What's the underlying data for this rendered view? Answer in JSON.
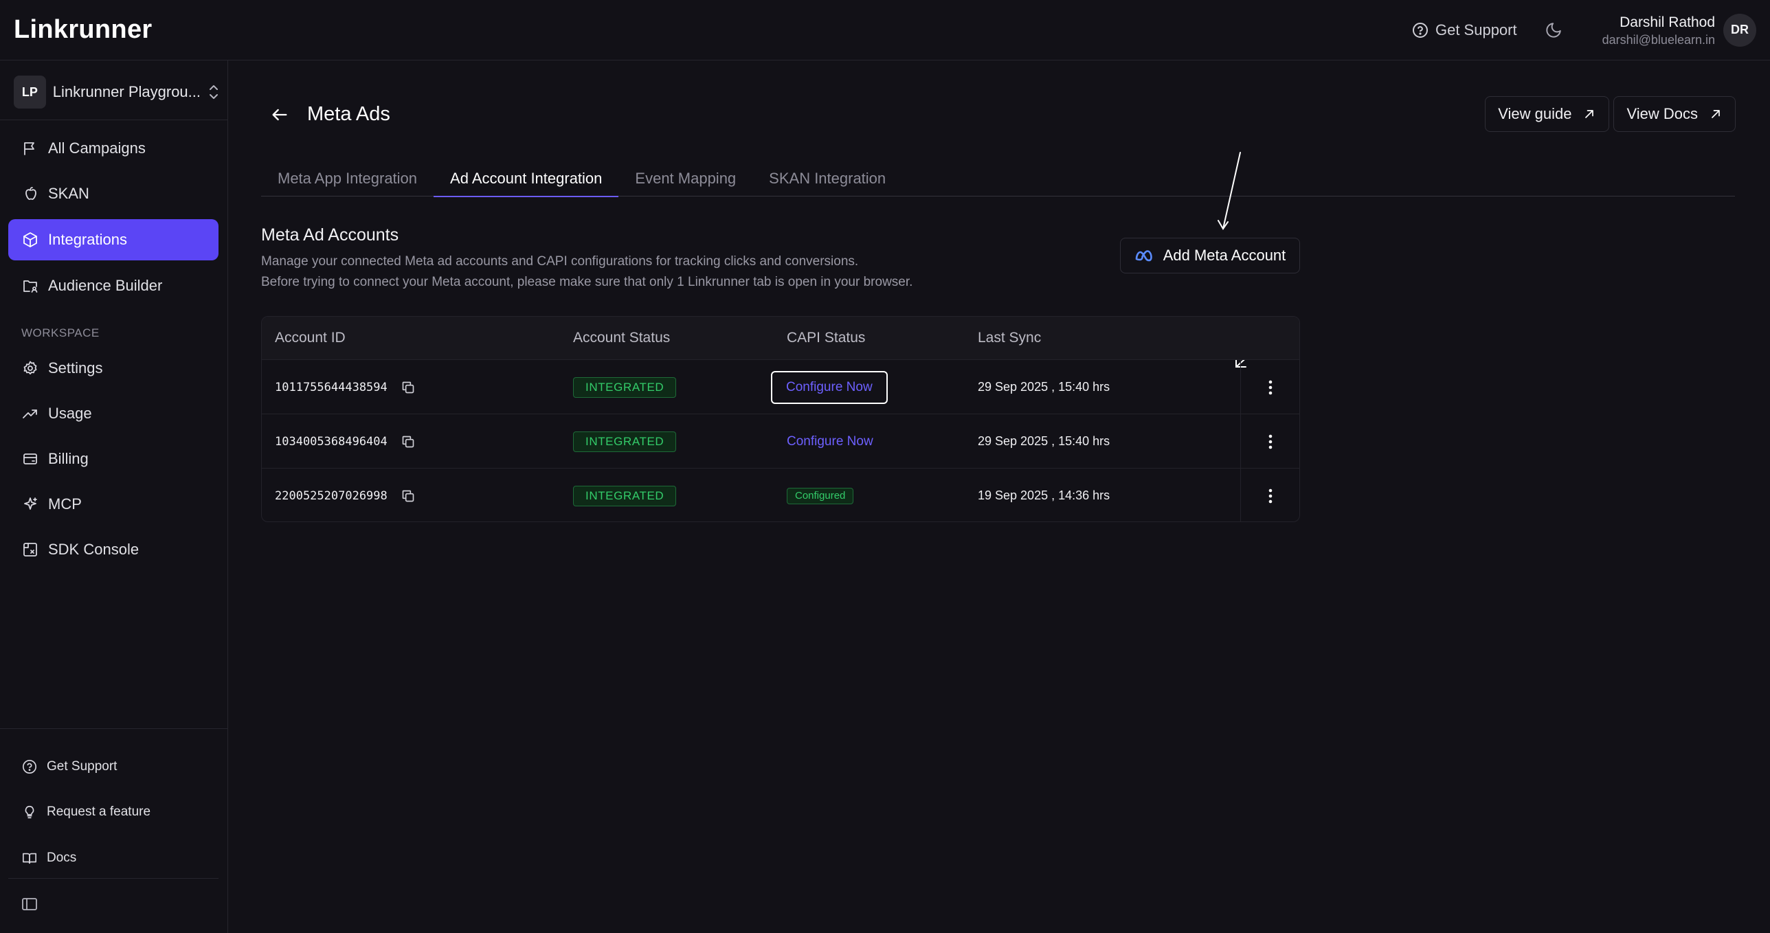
{
  "app": {
    "logo": "Linkrunner"
  },
  "topbar": {
    "support_label": "Get Support",
    "user_name": "Darshil Rathod",
    "user_email": "darshil@bluelearn.in",
    "user_initials": "DR"
  },
  "sidebar": {
    "workspace_initials": "LP",
    "workspace_name": "Linkrunner Playgrou...",
    "main_items": [
      {
        "label": "All Campaigns",
        "icon": "campaign-flag-icon"
      },
      {
        "label": "SKAN",
        "icon": "apple-icon"
      },
      {
        "label": "Integrations",
        "icon": "cube-icon",
        "active": true
      },
      {
        "label": "Audience Builder",
        "icon": "folder-user-icon"
      }
    ],
    "workspace_label": "WORKSPACE",
    "workspace_items": [
      {
        "label": "Settings",
        "icon": "gear-icon"
      },
      {
        "label": "Usage",
        "icon": "trend-up-icon"
      },
      {
        "label": "Billing",
        "icon": "wallet-icon"
      },
      {
        "label": "MCP",
        "icon": "sparkle-icon"
      },
      {
        "label": "SDK Console",
        "icon": "sdk-console-icon"
      }
    ],
    "bottom_items": [
      {
        "label": "Get Support",
        "icon": "help-circle-icon"
      },
      {
        "label": "Request a feature",
        "icon": "lightbulb-icon"
      },
      {
        "label": "Docs",
        "icon": "book-icon"
      }
    ]
  },
  "page": {
    "title": "Meta Ads",
    "view_guide_label": "View guide",
    "view_docs_label": "View Docs",
    "tabs": [
      {
        "label": "Meta App Integration",
        "active": false
      },
      {
        "label": "Ad Account Integration",
        "active": true
      },
      {
        "label": "Event Mapping",
        "active": false
      },
      {
        "label": "SKAN Integration",
        "active": false
      }
    ],
    "section_title": "Meta Ad Accounts",
    "section_desc_1": "Manage your connected Meta ad accounts and CAPI configurations for tracking clicks and conversions.",
    "section_desc_2": "Before trying to connect your Meta account, please make sure that only 1 Linkrunner tab is open in your browser.",
    "add_account_label": "Add Meta Account"
  },
  "table": {
    "columns": [
      "Account ID",
      "Account Status",
      "CAPI Status",
      "Last Sync"
    ],
    "rows": [
      {
        "account_id": "1011755644438594",
        "status": "INTEGRATED",
        "capi": "Configure Now",
        "capi_type": "link",
        "last_sync": "29 Sep 2025 , 15:40 hrs"
      },
      {
        "account_id": "1034005368496404",
        "status": "INTEGRATED",
        "capi": "Configure Now",
        "capi_type": "link",
        "last_sync": "29 Sep 2025 , 15:40 hrs"
      },
      {
        "account_id": "2200525207026998",
        "status": "INTEGRATED",
        "capi": "Configured",
        "capi_type": "badge",
        "last_sync": "19 Sep 2025 , 14:36 hrs"
      }
    ]
  },
  "colors": {
    "accent": "#5b45f5",
    "link": "#6d60ff",
    "success": "#33cc6a",
    "background": "#121117"
  }
}
